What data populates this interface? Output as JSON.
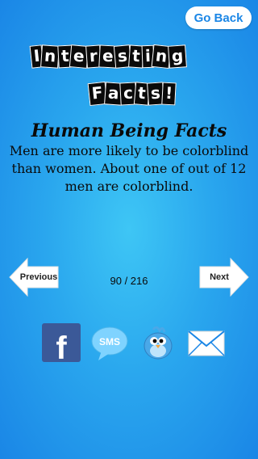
{
  "header": {
    "back_label": "Go Back"
  },
  "logo": {
    "line1": "Interesting",
    "line2": "Facts!"
  },
  "fact": {
    "category": "Human Being Facts",
    "text": "Men are more likely to be colorblind than women. About one of out of 12 men are colorblind."
  },
  "navigation": {
    "previous_label": "Previous",
    "next_label": "Next",
    "counter": "90 / 216"
  },
  "share": {
    "facebook_glyph": "f",
    "sms_label": "SMS"
  },
  "colors": {
    "background": "#2aa7ee",
    "accent": "#1a86e6",
    "facebook": "#3b5998"
  }
}
